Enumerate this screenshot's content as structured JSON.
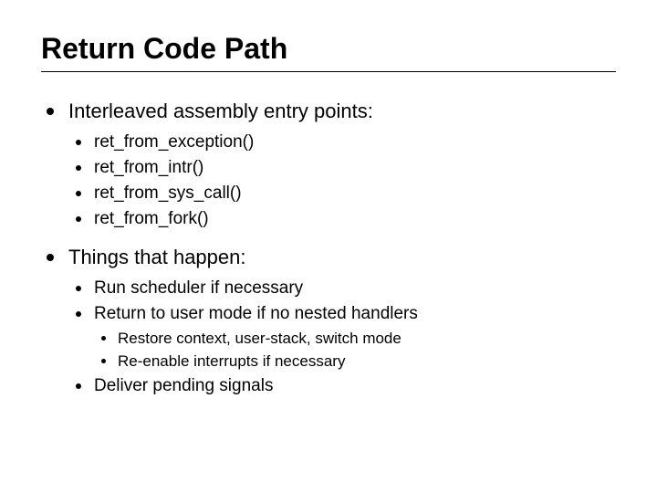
{
  "title": "Return Code Path",
  "points": [
    {
      "text": "Interleaved assembly entry points:",
      "sub": [
        {
          "text": "ret_from_exception()"
        },
        {
          "text": "ret_from_intr()"
        },
        {
          "text": "ret_from_sys_call()"
        },
        {
          "text": "ret_from_fork()"
        }
      ]
    },
    {
      "text": "Things that happen:",
      "sub": [
        {
          "text": "Run scheduler if necessary"
        },
        {
          "text": "Return to user mode if no nested handlers",
          "sub": [
            {
              "text": "Restore context, user-stack, switch mode"
            },
            {
              "text": "Re-enable interrupts if necessary"
            }
          ]
        },
        {
          "text": "Deliver pending signals"
        }
      ]
    }
  ]
}
